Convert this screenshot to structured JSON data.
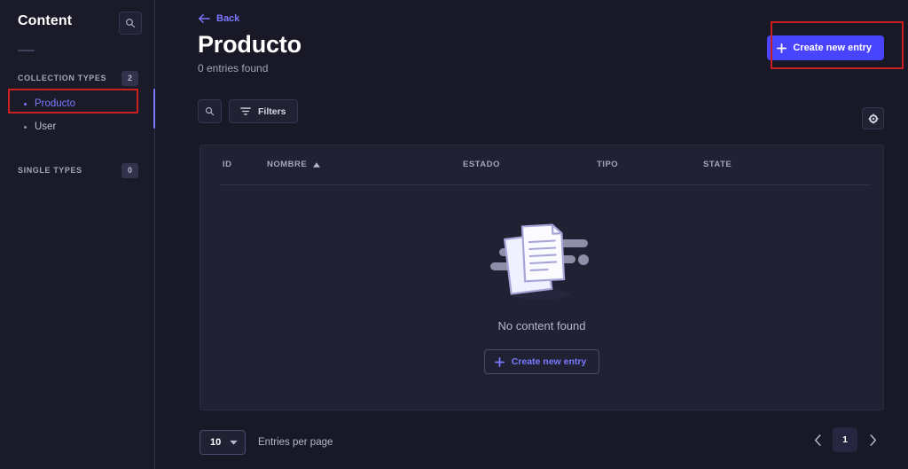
{
  "sidebar": {
    "title": "Content",
    "search_icon": "search-icon",
    "sections": [
      {
        "label": "COLLECTION TYPES",
        "badge": "2",
        "items": [
          {
            "label": "Producto",
            "active": true
          },
          {
            "label": "User",
            "active": false
          }
        ]
      },
      {
        "label": "SINGLE TYPES",
        "badge": "0",
        "items": []
      }
    ]
  },
  "header": {
    "back_label": "Back",
    "back_icon": "arrow-left-icon",
    "title": "Producto",
    "subtitle": "0 entries found",
    "create_label": "Create new entry",
    "create_icon": "plus-icon"
  },
  "toolbar": {
    "search_icon": "search-icon",
    "filters_label": "Filters",
    "filters_icon": "filter-icon",
    "settings_icon": "gear-icon"
  },
  "table": {
    "columns": [
      {
        "label": "ID",
        "sorted": false
      },
      {
        "label": "NOMBRE",
        "sorted": true,
        "sort_icon": "caret-up-icon"
      },
      {
        "label": "ESTADO",
        "sorted": false
      },
      {
        "label": "TIPO",
        "sorted": false
      },
      {
        "label": "STATE",
        "sorted": false
      }
    ],
    "rows": [],
    "empty_state": {
      "illustration": "documents-illustration",
      "message": "No content found",
      "button_label": "Create new entry",
      "button_icon": "plus-icon"
    }
  },
  "footer": {
    "entries_per_page_value": "10",
    "entries_per_page_label": "Entries per page",
    "dropdown_icon": "chevron-down-icon",
    "prev_icon": "chevron-left-icon",
    "next_icon": "chevron-right-icon",
    "current_page": "1"
  },
  "colors": {
    "accent": "#4945ff",
    "accent_text": "#7b79ff",
    "sidebar_bg": "#1a1a29",
    "main_bg": "#181826",
    "card_bg": "#212134",
    "annotation": "#cc1f1f"
  }
}
